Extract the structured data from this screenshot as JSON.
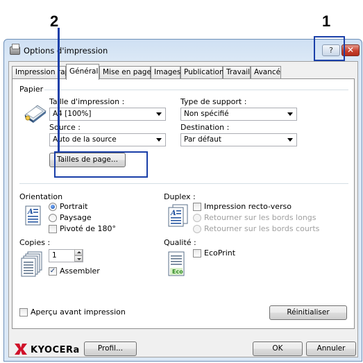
{
  "callouts": {
    "left": "2",
    "right": "1"
  },
  "window": {
    "title": "Options d'impression",
    "help_glyph": "?",
    "close_glyph": "✕"
  },
  "tabs": [
    {
      "label": "Impression rapide"
    },
    {
      "label": "Général",
      "active": true
    },
    {
      "label": "Mise en page"
    },
    {
      "label": "Images"
    },
    {
      "label": "Publication"
    },
    {
      "label": "Travail"
    },
    {
      "label": "Avancé"
    }
  ],
  "paper": {
    "group_label": "Papier",
    "print_size_label": "Taille d'impression :",
    "print_size_value": "A4  [100%]",
    "source_label": "Source :",
    "source_value": "Auto de la source",
    "media_type_label": "Type de support :",
    "media_type_value": "Non spécifié",
    "destination_label": "Destination :",
    "destination_value": "Par défaut",
    "page_sizes_button": "Tailles de page..."
  },
  "orientation": {
    "label": "Orientation",
    "portrait": "Portrait",
    "landscape": "Paysage",
    "rotated": "Pivoté de 180°"
  },
  "duplex": {
    "label": "Duplex :",
    "duplex_print": "Impression recto-verso",
    "flip_long": "Retourner sur les bords longs",
    "flip_short": "Retourner sur les bords courts"
  },
  "copies": {
    "label": "Copies :",
    "value": "1",
    "collate": "Assembler"
  },
  "quality": {
    "label": "Qualité :",
    "ecoprint": "EcoPrint",
    "eco_badge": "Eco"
  },
  "preview": {
    "label": "Aperçu avant impression"
  },
  "reset_button": "Réinitialiser",
  "footer": {
    "brand": "KYOCERa",
    "profile_button": "Profil...",
    "ok_button": "OK",
    "cancel_button": "Annuler"
  },
  "colors": {
    "highlight": "#1a3fa8",
    "brand_red": "#d0102a"
  }
}
